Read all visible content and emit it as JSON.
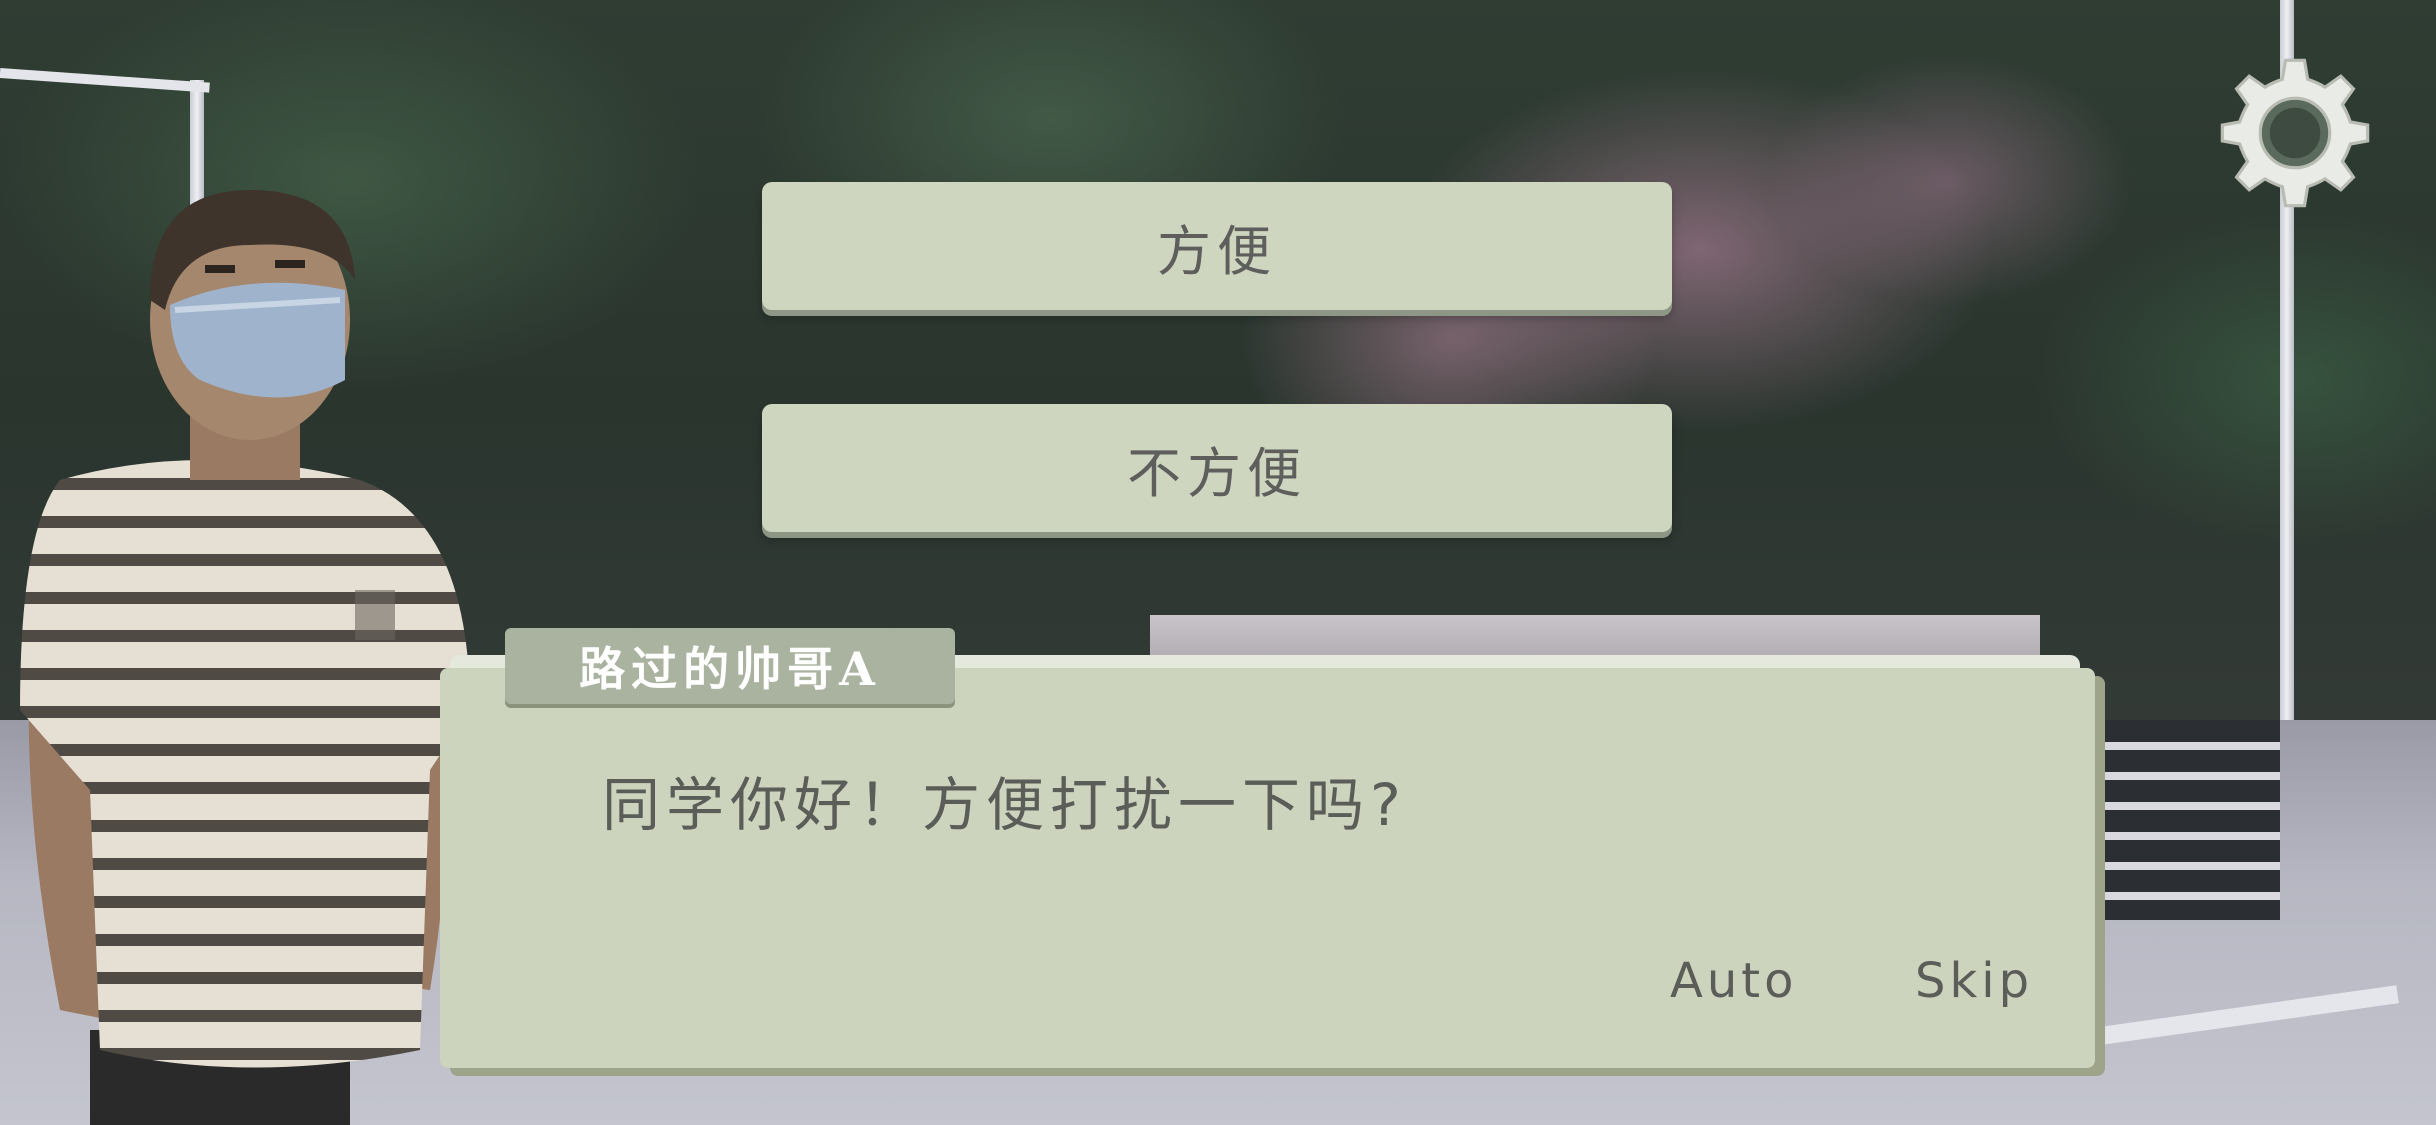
{
  "choices": [
    {
      "label": "方便"
    },
    {
      "label": "不方便"
    }
  ],
  "dialogue": {
    "speaker": "路过的帅哥A",
    "text": "同学你好！方便打扰一下吗?"
  },
  "controls": {
    "auto_label": "Auto",
    "skip_label": "Skip"
  },
  "icons": {
    "settings": "gear-icon"
  },
  "colors": {
    "button_fill": "#cfd6c0",
    "dialogue_fill": "#cdd4bd",
    "name_plate_fill": "#aab3a0",
    "text_color": "#5b5d59"
  }
}
